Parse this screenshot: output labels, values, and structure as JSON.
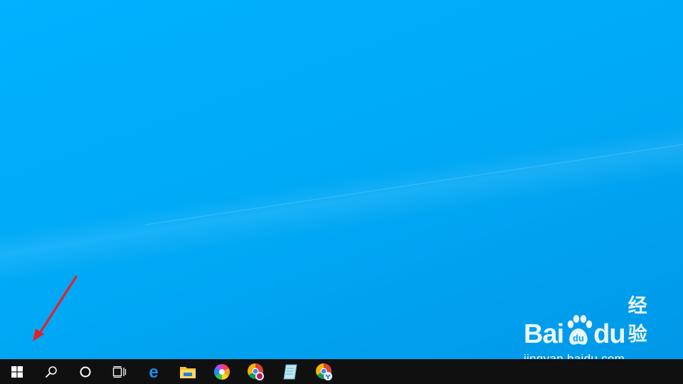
{
  "watermark": {
    "brand_part1": "Bai",
    "brand_part2": "du",
    "product": "经验",
    "url": "jingyan.baidu.com"
  },
  "taskbar": {
    "items": [
      {
        "icon": "windows-start-icon"
      },
      {
        "icon": "search-icon"
      },
      {
        "icon": "cortana-icon"
      },
      {
        "icon": "task-view-icon"
      },
      {
        "icon": "edge-browser-icon"
      },
      {
        "icon": "file-explorer-icon"
      },
      {
        "icon": "colorful-app-icon"
      },
      {
        "icon": "chrome-variant-icon"
      },
      {
        "icon": "notepad-app-icon"
      },
      {
        "icon": "chrome-variant-2-icon"
      }
    ]
  },
  "colors": {
    "desktop_background": "#00a8f5",
    "taskbar_background": "#101010",
    "annotation_arrow": "#e0232a"
  }
}
